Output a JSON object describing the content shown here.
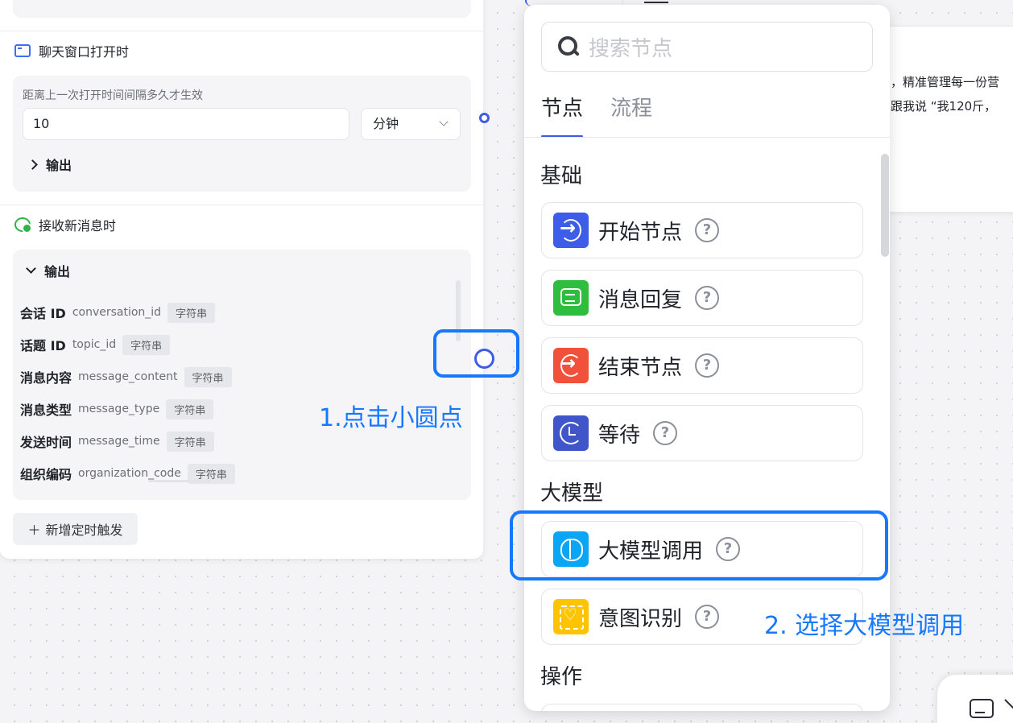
{
  "left_panel": {
    "window_section": {
      "title": "聊天窗口打开时",
      "interval_label": "距离上一次打开时间间隔多久才生效",
      "interval_value": "10",
      "unit_value": "分钟",
      "output_label": "输出"
    },
    "message_section": {
      "title": "接收新消息时",
      "output_label": "输出",
      "fields": [
        {
          "name": "会话 ID",
          "key": "conversation_id",
          "type": "字符串"
        },
        {
          "name": "话题 ID",
          "key": "topic_id",
          "type": "字符串"
        },
        {
          "name": "消息内容",
          "key": "message_content",
          "type": "字符串"
        },
        {
          "name": "消息类型",
          "key": "message_type",
          "type": "字符串"
        },
        {
          "name": "发送时间",
          "key": "message_time",
          "type": "字符串"
        },
        {
          "name": "组织编码",
          "key": "organization_code",
          "type": "字符串"
        }
      ]
    },
    "add_trigger_icon": "＋",
    "add_trigger_label": "新增定时触发"
  },
  "annotations": {
    "step1": "1.点击小圆点",
    "step2": "2. 选择大模型调用"
  },
  "background_node": {
    "line1": "，精准管理每一份营",
    "line2": "跟我说 “我120斤，"
  },
  "picker": {
    "search_placeholder": "搜索节点",
    "tabs": [
      {
        "label": "节点",
        "active": true
      },
      {
        "label": "流程",
        "active": false
      }
    ],
    "categories": {
      "basic": "基础",
      "llm": "大模型",
      "ops": "操作"
    },
    "items": [
      {
        "label": "开始节点",
        "icon": "start-arrow-icon",
        "color": "#3d5ce8"
      },
      {
        "label": "消息回复",
        "icon": "message-reply-icon",
        "color": "#2fbd3f"
      },
      {
        "label": "结束节点",
        "icon": "end-arrow-icon",
        "color": "#f1503a"
      },
      {
        "label": "等待",
        "icon": "wait-clock-icon",
        "color": "#3f55c9"
      },
      {
        "label": "大模型调用",
        "icon": "brain-icon",
        "color": "#0aa6f5"
      },
      {
        "label": "意图识别",
        "icon": "intent-scan-icon",
        "color": "#ffc400"
      }
    ],
    "help_glyph": "?"
  },
  "colors": {
    "accent_blue": "#1677ff",
    "node_dot": "#3d5ce8"
  }
}
